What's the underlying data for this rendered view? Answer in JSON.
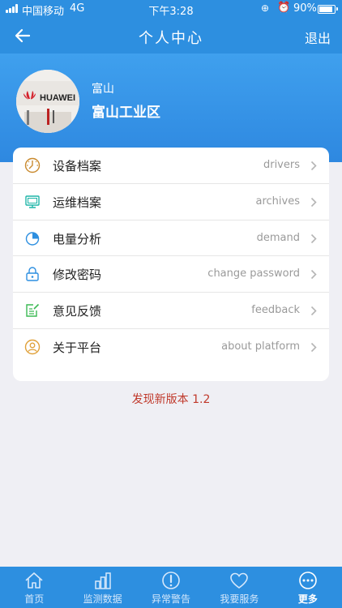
{
  "status_bar": {
    "carrier": "中国移动",
    "network": "4G",
    "time": "下午3:28",
    "battery": "90%",
    "battery_level": 0.9
  },
  "nav": {
    "title": "个人中心",
    "logout_label": "退出",
    "back_icon": "back-arrow-icon"
  },
  "profile": {
    "avatar_brand": "HUAWEI",
    "name": "富山",
    "organization": "富山工业区"
  },
  "menu": {
    "items": [
      {
        "label": "设备档案",
        "sub": "drivers",
        "icon": "dial-icon",
        "color": "#c98a2e"
      },
      {
        "label": "运维档案",
        "sub": "archives",
        "icon": "monitor-icon",
        "color": "#1fb5a8"
      },
      {
        "label": "电量分析",
        "sub": "demand",
        "icon": "pie-chart-icon",
        "color": "#2d8fe0"
      },
      {
        "label": "修改密码",
        "sub": "change password",
        "icon": "lock-icon",
        "color": "#2d8fe0"
      },
      {
        "label": "意见反馈",
        "sub": "feedback",
        "icon": "feedback-icon",
        "color": "#3cba54"
      },
      {
        "label": "关于平台",
        "sub": "about platform",
        "icon": "user-circle-icon",
        "color": "#e0a13a"
      }
    ]
  },
  "version_notice": "发现新版本 1.2",
  "tab_bar": {
    "tabs": [
      {
        "label": "首页",
        "icon": "home-icon"
      },
      {
        "label": "监测数据",
        "icon": "bar-chart-icon"
      },
      {
        "label": "异常警告",
        "icon": "alert-icon"
      },
      {
        "label": "我要服务",
        "icon": "heart-icon"
      },
      {
        "label": "更多",
        "icon": "more-icon",
        "active": true
      }
    ]
  },
  "colors": {
    "primary": "#2d8fe0",
    "version_text": "#c0392b"
  }
}
